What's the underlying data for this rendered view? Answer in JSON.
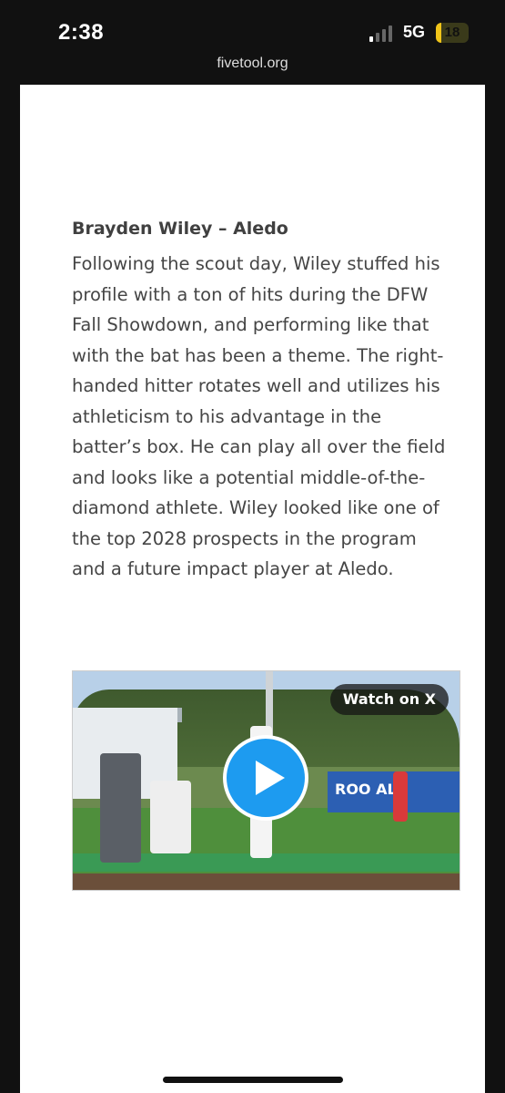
{
  "status_bar": {
    "time": "2:38",
    "network": "5G",
    "battery_level": "18",
    "battery_fraction": 0.18,
    "signal_bars_active": 1
  },
  "browser": {
    "url": "fivetool.org"
  },
  "article": {
    "title": "Brayden Wiley – Aledo",
    "body": "Following the scout day, Wiley stuffed his profile with a ton of hits during the DFW Fall Showdown, and performing like that with the bat has been a theme. The right-handed hitter rotates well and utilizes his athleticism to his advantage in the batter’s box. He can play all over the field and looks like a potential middle-of-the-diamond athlete. Wiley looked like one of the top 2028 prospects in the program and a future impact player at Aledo."
  },
  "video": {
    "watch_label": "Watch on X",
    "fence_text": "ROO  AL",
    "play_icon": "play-icon"
  },
  "colors": {
    "accent": "#1d9bf0",
    "battery": "#f0c419"
  }
}
